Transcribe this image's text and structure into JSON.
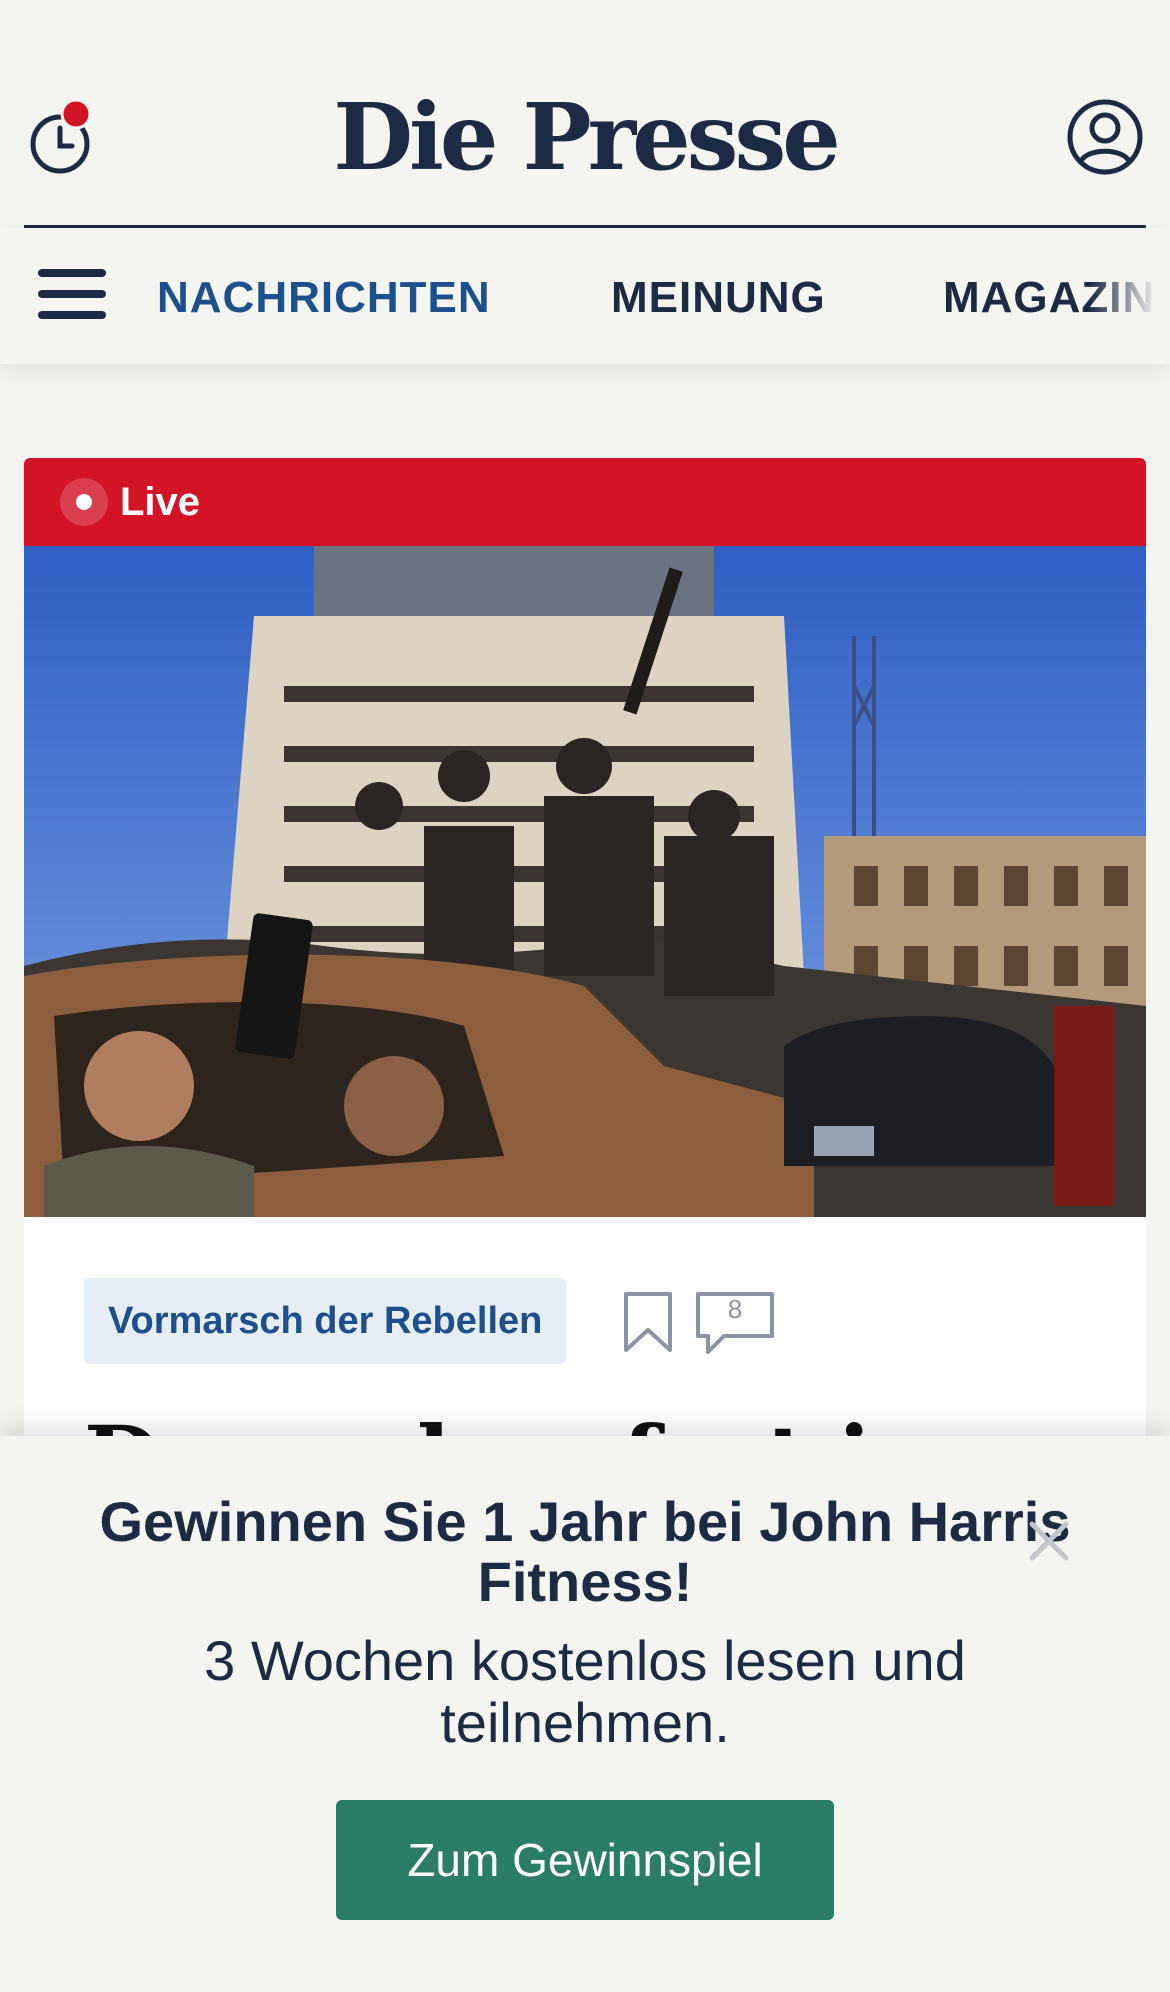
{
  "header": {
    "logo": "Die Presse",
    "history_icon": "clock-notification-icon",
    "profile_icon": "user-profile-icon"
  },
  "nav": {
    "menu_icon": "hamburger-menu-icon",
    "items": [
      {
        "label": "NACHRICHTEN",
        "active": true
      },
      {
        "label": "MEINUNG",
        "active": false
      },
      {
        "label": "MAGAZIN",
        "active": false
      }
    ]
  },
  "article": {
    "live_label": "Live",
    "tag": "Vormarsch der Rebellen",
    "bookmark_icon": "bookmark-icon",
    "comment_icon": "comment-icon",
    "comment_count": "8",
    "headline_peek": "Damaskus fast in"
  },
  "promo": {
    "title": "Gewinnen Sie 1 Jahr bei John Harris Fitness!",
    "subtitle": "3 Wochen kostenlos lesen und teilnehmen.",
    "button_label": "Zum Gewinnspiel",
    "close_icon": "close-icon"
  },
  "colors": {
    "brand_navy": "#1c2a44",
    "nav_active": "#1d4f8c",
    "live_red": "#d21426",
    "cta_green": "#2a7d66",
    "background": "#f4f4f0"
  }
}
